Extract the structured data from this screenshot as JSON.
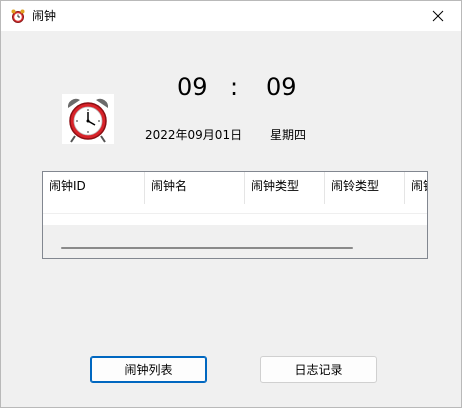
{
  "window": {
    "title": "闹钟"
  },
  "clock": {
    "hours": "09",
    "separator": ":",
    "minutes": "09",
    "date": "2022年09月01日",
    "weekday": "星期四"
  },
  "grid": {
    "columns": [
      "闹钟ID",
      "闹钟名",
      "闹钟类型",
      "闹铃类型",
      "闹铃"
    ]
  },
  "buttons": {
    "list": "闹钟列表",
    "log": "日志记录"
  },
  "icons": {
    "app": "alarm-clock-icon",
    "close": "close-icon",
    "clock": "alarm-clock-icon"
  },
  "colors": {
    "accent": "#0067c0",
    "background": "#f0f0f0"
  }
}
